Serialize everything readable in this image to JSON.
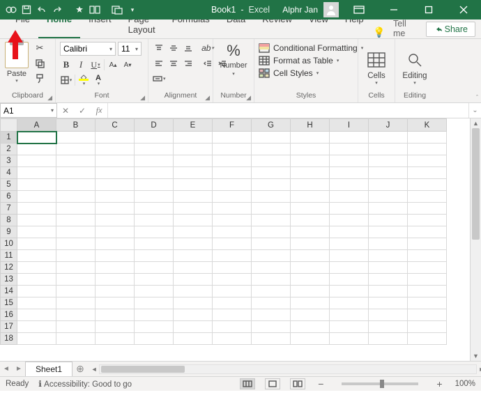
{
  "titlebar": {
    "doc_title": "Book1",
    "app_name": "Excel",
    "username": "Alphr Jan"
  },
  "tabs": {
    "items": [
      "File",
      "Home",
      "Insert",
      "Page Layout",
      "Formulas",
      "Data",
      "Review",
      "View",
      "Help"
    ],
    "active_index": 1,
    "tellme": "Tell me",
    "share": "Share"
  },
  "ribbon": {
    "clipboard": {
      "label": "Clipboard",
      "paste": "Paste"
    },
    "font": {
      "label": "Font",
      "name": "Calibri",
      "size": "11"
    },
    "alignment": {
      "label": "Alignment"
    },
    "number": {
      "label": "Number",
      "big": "%"
    },
    "styles": {
      "label": "Styles",
      "conditional": "Conditional Formatting",
      "table": "Format as Table",
      "cellstyles": "Cell Styles"
    },
    "cells": {
      "label": "Cells"
    },
    "editing": {
      "label": "Editing"
    }
  },
  "namebox": "A1",
  "grid": {
    "columns": [
      "A",
      "B",
      "C",
      "D",
      "E",
      "F",
      "G",
      "H",
      "I",
      "J",
      "K"
    ],
    "rows": [
      "1",
      "2",
      "3",
      "4",
      "5",
      "6",
      "7",
      "8",
      "9",
      "10",
      "11",
      "12",
      "13",
      "14",
      "15",
      "16",
      "17",
      "18"
    ],
    "active_cell": "A1"
  },
  "sheet_tabs": {
    "active": "Sheet1"
  },
  "status": {
    "ready": "Ready",
    "accessibility": "Accessibility: Good to go",
    "zoom": "100%"
  }
}
